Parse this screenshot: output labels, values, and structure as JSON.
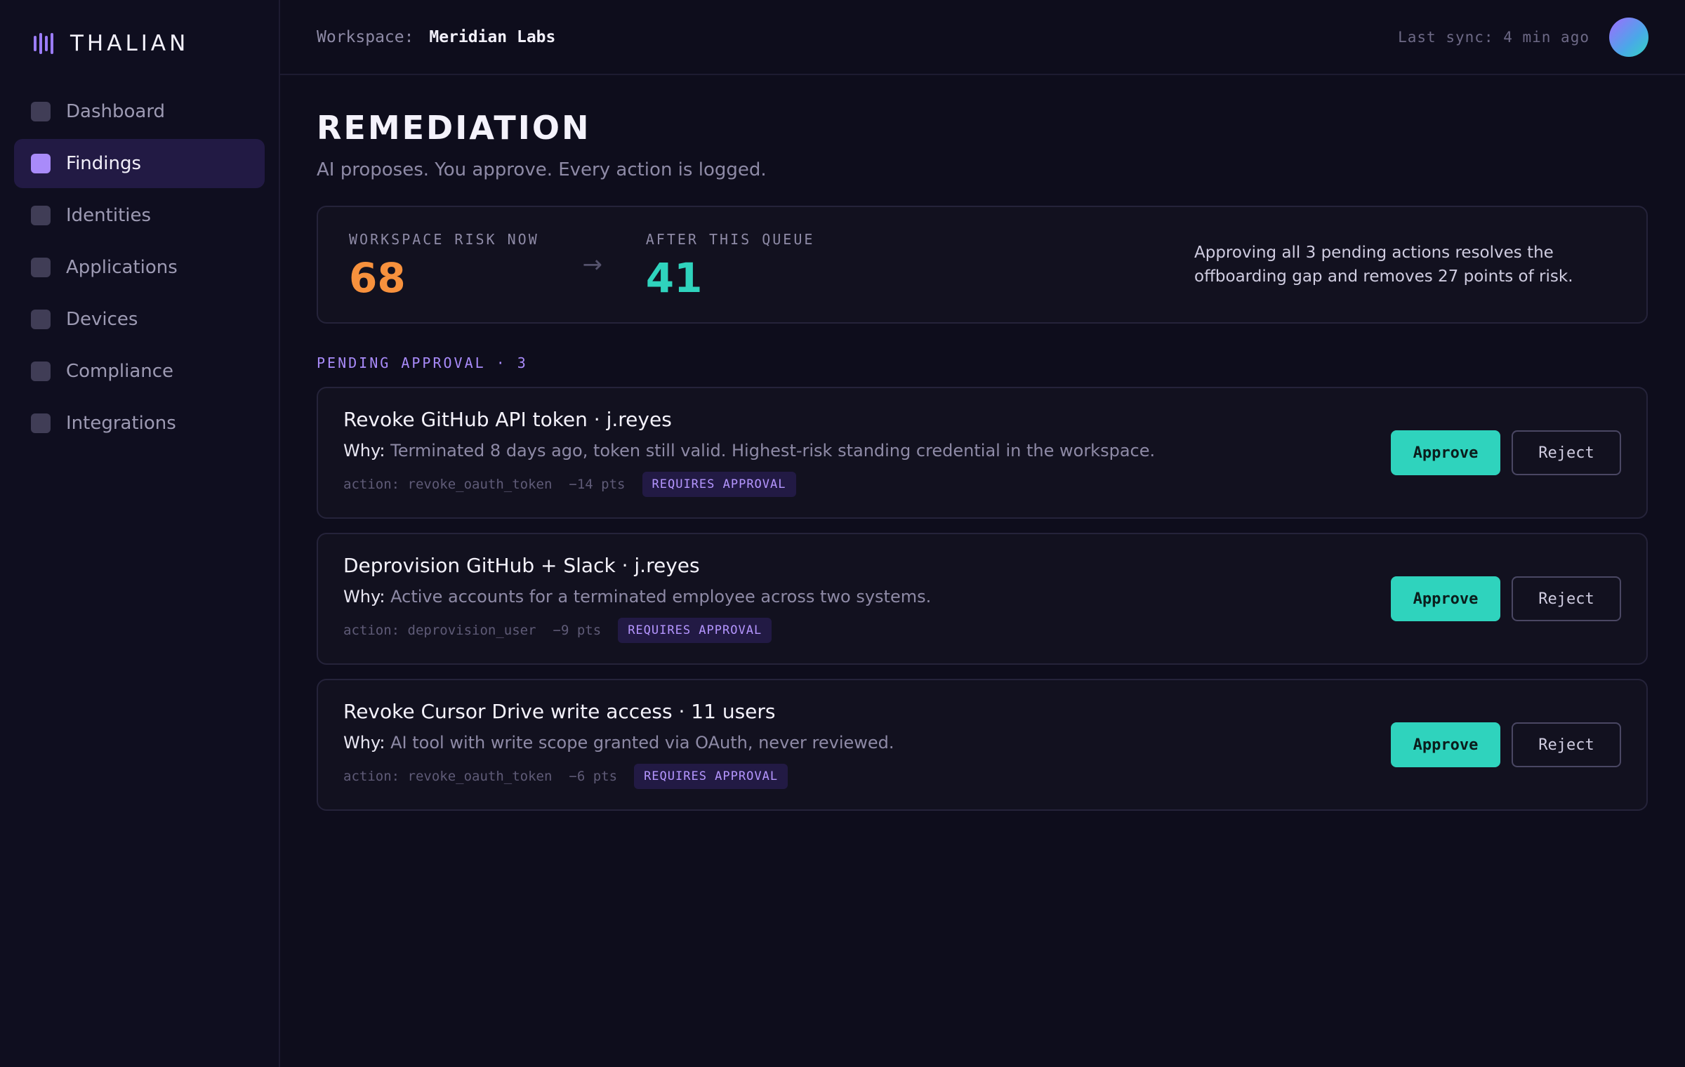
{
  "brand": {
    "name": "THALIAN",
    "icon": "bars-icon"
  },
  "sidebar": {
    "items": [
      {
        "label": "Dashboard",
        "active": false
      },
      {
        "label": "Findings",
        "active": true
      },
      {
        "label": "Identities",
        "active": false
      },
      {
        "label": "Applications",
        "active": false
      },
      {
        "label": "Devices",
        "active": false
      },
      {
        "label": "Compliance",
        "active": false
      },
      {
        "label": "Integrations",
        "active": false
      }
    ]
  },
  "header": {
    "workspace_label": "Workspace:",
    "workspace_name": "Meridian Labs",
    "last_sync": "Last sync: 4 min ago"
  },
  "page": {
    "title": "REMEDIATION",
    "subtitle": "AI proposes. You approve. Every action is logged."
  },
  "risk": {
    "now_label": "WORKSPACE RISK NOW",
    "now_value": "68",
    "arrow": "→",
    "after_label": "AFTER THIS QUEUE",
    "after_value": "41",
    "note": "Approving all 3 pending actions resolves the offboarding gap and removes 27 points of risk."
  },
  "queue": {
    "label": "PENDING APPROVAL · 3",
    "actions": [
      {
        "title": "Revoke GitHub API token · j.reyes",
        "why_label": "Why:",
        "why": "Terminated 8 days ago, token still valid. Highest-risk standing credential in the workspace.",
        "action": "action: revoke_oauth_token",
        "points": "−14 pts",
        "badge": "REQUIRES APPROVAL",
        "approve": "Approve",
        "reject": "Reject"
      },
      {
        "title": "Deprovision GitHub + Slack · j.reyes",
        "why_label": "Why:",
        "why": "Active accounts for a terminated employee across two systems.",
        "action": "action: deprovision_user",
        "points": "−9 pts",
        "badge": "REQUIRES APPROVAL",
        "approve": "Approve",
        "reject": "Reject"
      },
      {
        "title": "Revoke Cursor Drive write access · 11 users",
        "why_label": "Why:",
        "why": "AI tool with write scope granted via OAuth, never reviewed.",
        "action": "action: revoke_oauth_token",
        "points": "−6 pts",
        "badge": "REQUIRES APPROVAL",
        "approve": "Approve",
        "reject": "Reject"
      }
    ]
  },
  "colors": {
    "accent": "#a98bfa",
    "approve": "#2fd3bd",
    "risk_now": "#f7913d",
    "risk_after": "#2fd3bd"
  }
}
